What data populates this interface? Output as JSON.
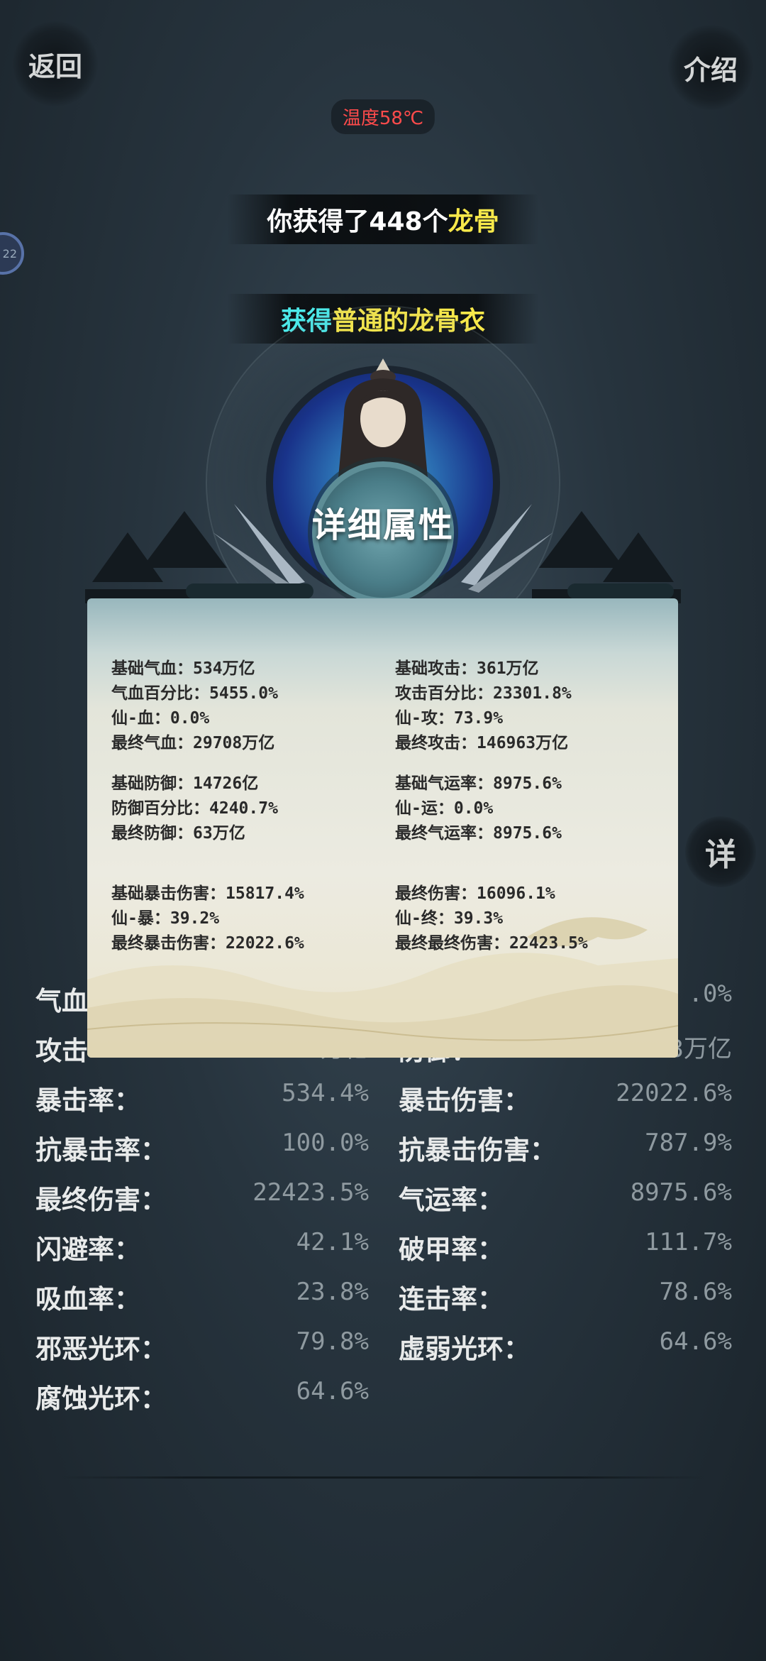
{
  "top": {
    "back_label": "返回",
    "intro_label": "介绍",
    "temperature": "温度58℃"
  },
  "side_badge": "22",
  "banner1": {
    "prefix": "你获得了448个",
    "item": "龙骨"
  },
  "banner2": {
    "prefix": "获得 ",
    "item": "普通的龙骨衣"
  },
  "panel": {
    "title": "详细属性",
    "left_groups": [
      [
        "基础气血：534万亿",
        "气血百分比：5455.0%",
        "仙-血：0.0%",
        "最终气血：29708万亿"
      ],
      [
        "基础防御：14726亿",
        "防御百分比：4240.7%",
        "最终防御：63万亿"
      ],
      [
        "基础暴击伤害：15817.4%",
        "仙-暴：39.2%",
        "最终暴击伤害：22022.6%"
      ]
    ],
    "right_groups": [
      [
        "基础攻击：361万亿",
        "攻击百分比：23301.8%",
        "仙-攻：73.9%",
        "最终攻击：146963万亿"
      ],
      [
        "基础气运率：8975.6%",
        "仙-运：0.0%",
        "最终气运率：8975.6%"
      ],
      [
        "最终伤害：16096.1%",
        "仙-终：39.3%",
        "最终最终伤害：22423.5%"
      ]
    ]
  },
  "detail_btn_label": "详",
  "bg_stats": [
    {
      "l": "气血",
      "lv": "",
      "r": "",
      "rv": ".0%"
    },
    {
      "l": "攻击",
      "lv": "146963万亿",
      "r": "防御：",
      "rv": "63万亿"
    },
    {
      "l": "暴击率：",
      "lv": "534.4%",
      "r": "暴击伤害：",
      "rv": "22022.6%"
    },
    {
      "l": "抗暴击率：",
      "lv": "100.0%",
      "r": "抗暴击伤害：",
      "rv": "787.9%"
    },
    {
      "l": "最终伤害：",
      "lv": "22423.5%",
      "r": "气运率：",
      "rv": "8975.6%"
    },
    {
      "l": "闪避率：",
      "lv": "42.1%",
      "r": "破甲率：",
      "rv": "111.7%"
    },
    {
      "l": "吸血率：",
      "lv": "23.8%",
      "r": "连击率：",
      "rv": "78.6%"
    },
    {
      "l": "邪恶光环：",
      "lv": "79.8%",
      "r": "虚弱光环：",
      "rv": "64.6%"
    },
    {
      "l": "腐蚀光环：",
      "lv": "64.6%",
      "r": "",
      "rv": ""
    }
  ],
  "colors": {
    "temperature": "#ff4b4b",
    "highlight_yellow": "#f7e84a",
    "highlight_cyan": "#4ce8e8"
  }
}
